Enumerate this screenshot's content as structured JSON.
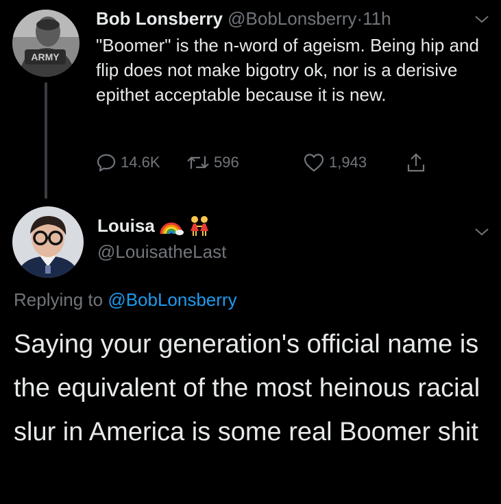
{
  "parent_tweet": {
    "display_name": "Bob Lonsberry",
    "handle": "@BobLonsberry",
    "separator": "·",
    "time": "11h",
    "text": "\"Boomer\" is the n-word of ageism. Being hip and flip does not make bigotry ok, nor is a derisive epithet acceptable because it is new.",
    "avatar_caption": "ARMY",
    "stats": {
      "replies": "14.6K",
      "retweets": "596",
      "likes": "1,943"
    }
  },
  "reply_tweet": {
    "display_name": "Louisa",
    "handle": "@LouisatheLast",
    "replying_prefix": "Replying to",
    "replying_to": "@BobLonsberry",
    "text": "Saying your generation's official name is the equivalent of the most heinous racial slur in America is some real Boomer shit"
  },
  "icons": [
    "chevron-down-icon",
    "reply-icon",
    "retweet-icon",
    "like-icon",
    "share-icon",
    "rainbow-emoji",
    "two-women-emoji"
  ],
  "colors": {
    "background": "#000000",
    "primary_text": "#e7e9ea",
    "secondary_text": "#71767b",
    "link": "#1d9bf0",
    "thread_line": "#3a3d41"
  }
}
